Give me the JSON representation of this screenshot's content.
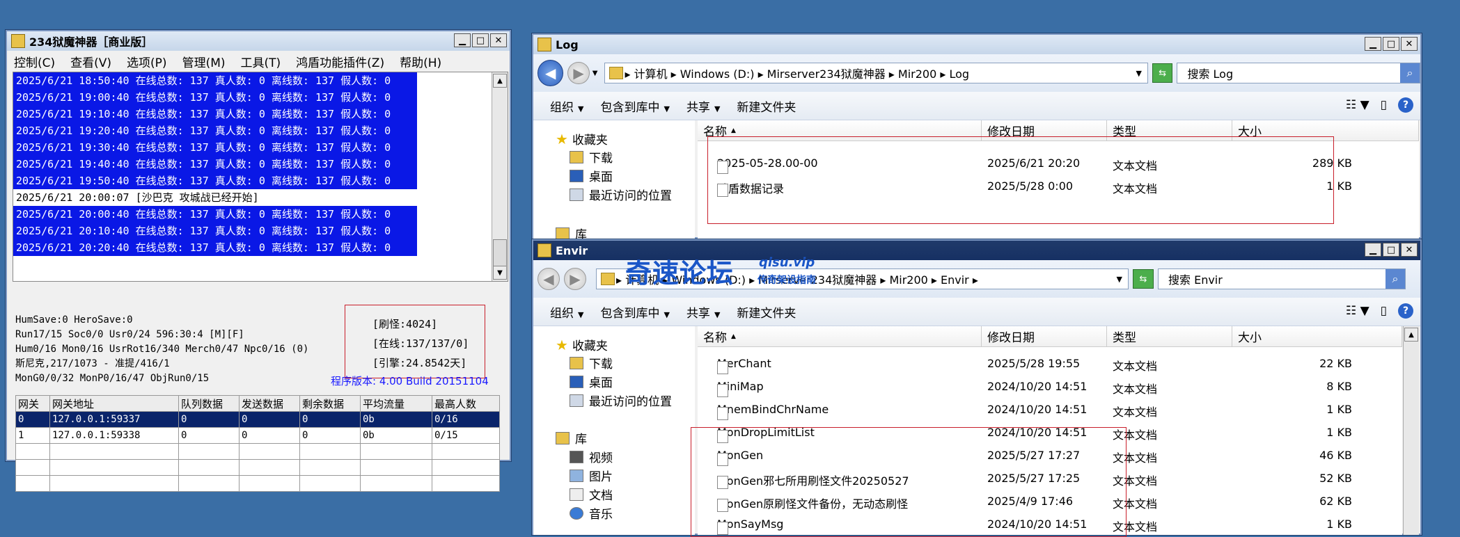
{
  "mir": {
    "title": "234狱魔神器［商业版］",
    "menu": [
      "控制(C)",
      "查看(V)",
      "选项(P)",
      "管理(M)",
      "工具(T)",
      "鸿盾功能插件(Z)",
      "帮助(H)"
    ],
    "log": [
      {
        "text": "2025/6/21 18:50:40 在线总数: 137 真人数: 0 离线数: 137 假人数: 0",
        "sel": true
      },
      {
        "text": "2025/6/21 19:00:40 在线总数: 137 真人数: 0 离线数: 137 假人数: 0",
        "sel": true
      },
      {
        "text": "2025/6/21 19:10:40 在线总数: 137 真人数: 0 离线数: 137 假人数: 0",
        "sel": true
      },
      {
        "text": "2025/6/21 19:20:40 在线总数: 137 真人数: 0 离线数: 137 假人数: 0",
        "sel": true
      },
      {
        "text": "2025/6/21 19:30:40 在线总数: 137 真人数: 0 离线数: 137 假人数: 0",
        "sel": true
      },
      {
        "text": "2025/6/21 19:40:40 在线总数: 137 真人数: 0 离线数: 137 假人数: 0",
        "sel": true
      },
      {
        "text": "2025/6/21 19:50:40 在线总数: 137 真人数: 0 离线数: 137 假人数: 0",
        "sel": true
      },
      {
        "text": "2025/6/21 20:00:07 [沙巴克 攻城战已经开始]",
        "sel": false
      },
      {
        "text": "2025/6/21 20:00:40 在线总数: 137 真人数: 0 离线数: 137 假人数: 0",
        "sel": true
      },
      {
        "text": "2025/6/21 20:10:40 在线总数: 137 真人数: 0 离线数: 137 假人数: 0",
        "sel": true
      },
      {
        "text": "2025/6/21 20:20:40 在线总数: 137 真人数: 0 离线数: 137 假人数: 0",
        "sel": true
      }
    ],
    "status": [
      "HumSave:0 HeroSave:0",
      "Run17/15 Soc0/0 Usr0/24          596:30:4 [M][F]",
      "Hum0/16 Mon0/16 UsrRot16/340 Merch0/47 Npc0/16 (0)",
      "斯尼克,217/1073 - 准提/416/1",
      "MonG0/0/32 MonP0/16/47 ObjRun0/15"
    ],
    "stats": [
      "[刷怪:4024]",
      "[在线:137/137/0]",
      "[引擎:24.8542天]"
    ],
    "version": "程序版本: 4.00 Build 20151104",
    "grid": {
      "headers": [
        "网关",
        "网关地址",
        "队列数据",
        "发送数据",
        "剩余数据",
        "平均流量",
        "最高人数"
      ],
      "rows": [
        [
          "0",
          "127.0.0.1:59337",
          "0",
          "0",
          "0",
          "0b",
          "0/16"
        ],
        [
          "1",
          "127.0.0.1:59338",
          "0",
          "0",
          "0",
          "0b",
          "0/15"
        ]
      ]
    }
  },
  "log_win": {
    "title": "Log",
    "breadcrumb": "▸ 计算机 ▸ Windows (D:) ▸ Mirserver234狱魔神器 ▸ Mir200 ▸ Log",
    "search_placeholder": "搜索 Log",
    "toolbar": [
      "组织",
      "包含到库中",
      "共享",
      "新建文件夹"
    ],
    "nav": {
      "favorites": "收藏夹",
      "downloads": "下载",
      "desktop": "桌面",
      "recent": "最近访问的位置",
      "library": "库"
    },
    "columns": [
      "名称",
      "修改日期",
      "类型",
      "大小"
    ],
    "files": [
      {
        "name": "2025-05-28.00-00",
        "date": "2025/6/21 20:20",
        "type": "文本文档",
        "size": "289 KB"
      },
      {
        "name": "鸿盾数据记录",
        "date": "2025/5/28 0:00",
        "type": "文本文档",
        "size": "1 KB"
      }
    ]
  },
  "envir_win": {
    "title": "Envir",
    "breadcrumb": "▸ 计算机 ▸ Windows (D:) ▸ Mirserver234狱魔神器 ▸ Mir200 ▸ Envir ▸",
    "search_placeholder": "搜索 Envir",
    "toolbar": [
      "组织",
      "包含到库中",
      "共享",
      "新建文件夹"
    ],
    "nav": {
      "favorites": "收藏夹",
      "downloads": "下载",
      "desktop": "桌面",
      "recent": "最近访问的位置",
      "library": "库",
      "video": "视频",
      "pictures": "图片",
      "docs": "文档",
      "music": "音乐"
    },
    "columns": [
      "名称",
      "修改日期",
      "类型",
      "大小"
    ],
    "files": [
      {
        "name": "MerChant",
        "date": "2025/5/28 19:55",
        "type": "文本文档",
        "size": "22 KB"
      },
      {
        "name": "MiniMap",
        "date": "2024/10/20 14:51",
        "type": "文本文档",
        "size": "8 KB"
      },
      {
        "name": "MnemBindChrName",
        "date": "2024/10/20 14:51",
        "type": "文本文档",
        "size": "1 KB"
      },
      {
        "name": "MonDropLimitList",
        "date": "2024/10/20 14:51",
        "type": "文本文档",
        "size": "1 KB"
      },
      {
        "name": "MonGen",
        "date": "2025/5/27 17:27",
        "type": "文本文档",
        "size": "46 KB"
      },
      {
        "name": "MonGen邪七所用刷怪文件20250527",
        "date": "2025/5/27 17:25",
        "type": "文本文档",
        "size": "52 KB"
      },
      {
        "name": "MonGen原刷怪文件备份，无动态刷怪",
        "date": "2025/4/9 17:46",
        "type": "文本文档",
        "size": "62 KB"
      },
      {
        "name": "MonSayMsg",
        "date": "2024/10/20 14:51",
        "type": "文本文档",
        "size": "1 KB"
      }
    ]
  },
  "watermark": {
    "main": "奇速论坛",
    "url": "qisu.vip",
    "sub": "传奇架设指南"
  }
}
